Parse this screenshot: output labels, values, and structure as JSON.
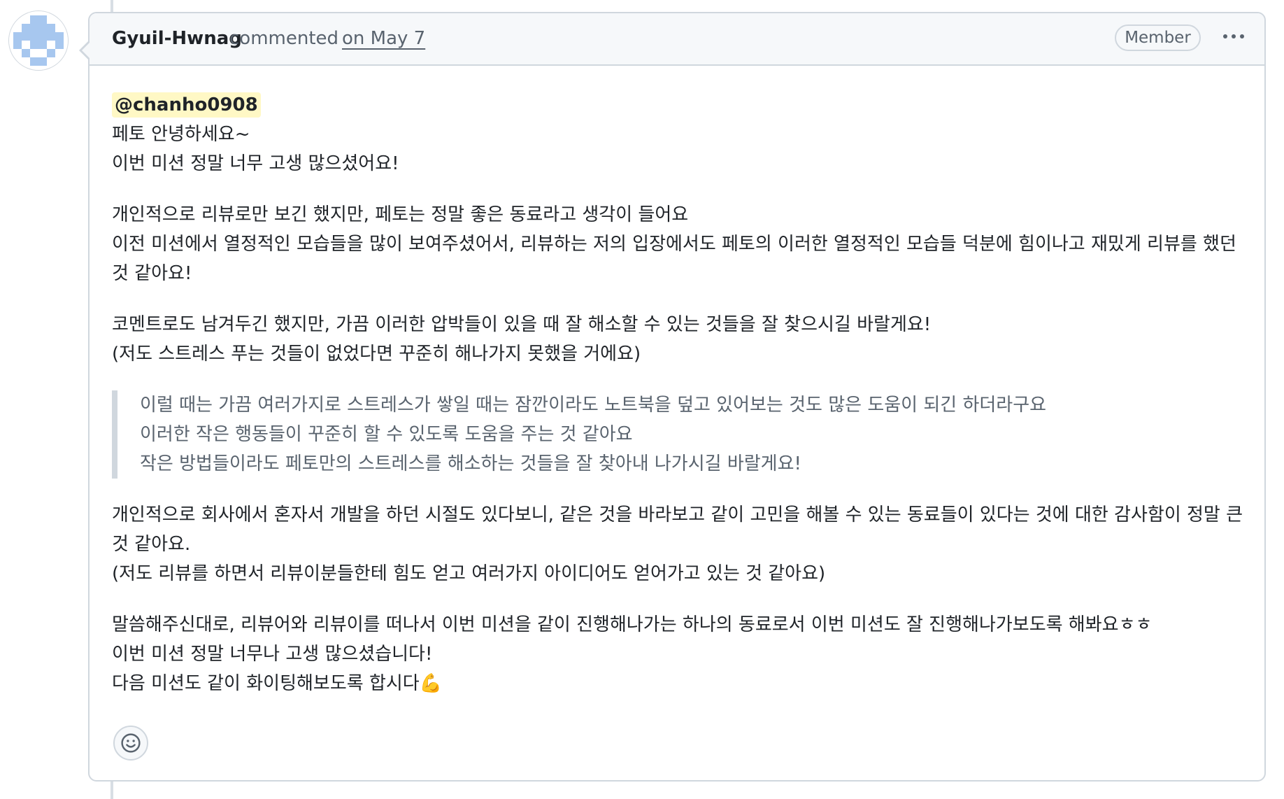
{
  "comment": {
    "author": "Gyuil-Hwnag",
    "action": "commented",
    "date": "on May 7",
    "role_badge": "Member",
    "more_options_icon": "kebab-horizontal-icon",
    "avatar": {
      "type": "identicon",
      "colors": [
        "#a7c7ef",
        "#6a9ad4",
        "#ffffff"
      ]
    },
    "mention": "@chanho0908",
    "body": {
      "p1": "페토 안녕하세요~\n이번 미션 정말 너무 고생 많으셨어요!",
      "p2": "개인적으로 리뷰로만 보긴 했지만, 페토는 정말 좋은 동료라고 생각이 들어요\n이전 미션에서 열정적인 모습들을 많이 보여주셨어서, 리뷰하는 저의 입장에서도 페토의 이러한 열정적인 모습들 덕분에 힘이나고 재밌게 리뷰를 했던 것 같아요!",
      "p3": "코멘트로도 남겨두긴 했지만, 가끔 이러한 압박들이 있을 때 잘 해소할 수 있는 것들을 잘 찾으시길 바랄게요!\n(저도 스트레스 푸는 것들이 없었다면 꾸준히 해나가지 못했을 거에요)",
      "quote": "이럴 때는 가끔 여러가지로 스트레스가 쌓일 때는 잠깐이라도 노트북을 덮고 있어보는 것도 많은 도움이 되긴 하더라구요\n이러한 작은 행동들이 꾸준히 할 수 있도록 도움을 주는 것 같아요\n작은 방법들이라도 페토만의 스트레스를 해소하는 것들을 잘 찾아내 나가시길 바랄게요!",
      "p4": "개인적으로 회사에서 혼자서 개발을 하던 시절도 있다보니, 같은 것을 바라보고 같이 고민을 해볼 수 있는 동료들이 있다는 것에 대한 감사함이 정말 큰 것 같아요.\n(저도 리뷰를 하면서 리뷰이분들한테 힘도 얻고 여러가지 아이디어도 얻어가고 있는 것 같아요)",
      "p5": "말씀해주신대로, 리뷰어와 리뷰이를 떠나서 이번 미션을 같이 진행해나가는 하나의 동료로서 이번 미션도 잘 진행해나가보도록 해봐요ㅎㅎ\n이번 미션 정말 너무나 고생 많으셨습니다!\n다음 미션도 같이 화이팅해보도록 합시다💪"
    },
    "reaction_icon": "smiley-icon"
  },
  "colors": {
    "border": "#d0d7de",
    "header_bg": "#f6f8fa",
    "muted_text": "#59636e",
    "mention_bg": "#fff8c5"
  }
}
